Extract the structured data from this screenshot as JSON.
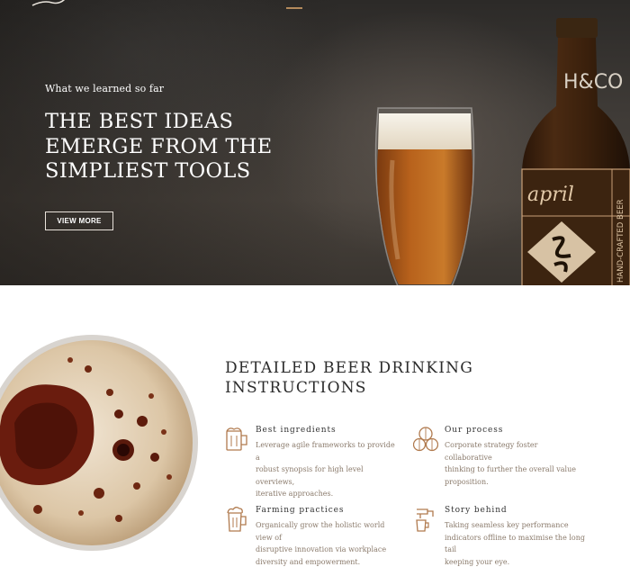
{
  "hero": {
    "eyebrow": "What we learned so far",
    "headline_lines": [
      "THE BEST IDEAS",
      "EMERGE FROM THE",
      "SIMPLIEST TOOLS"
    ],
    "button_label": "VIEW MORE",
    "accent_color": "#b48a5c",
    "bottle_label": {
      "brand": "H&CO",
      "script_text": "april",
      "vertical_text": "HAND-CRAFTED BEER"
    }
  },
  "section": {
    "title_lines": [
      "DETAILED BEER DRINKING",
      "INSTRUCTIONS"
    ],
    "features": [
      {
        "title": "Best ingredients",
        "icon": "beer-mug-icon",
        "lines": [
          "Leverage agile frameworks to provide a",
          "robust synopsis for high level overviews,",
          "iterative approaches."
        ]
      },
      {
        "title": "Our process",
        "icon": "barrels-icon",
        "lines": [
          "Corporate strategy foster collaborative",
          "thinking to further the overall value",
          "proposition."
        ]
      },
      {
        "title": "Farming practices",
        "icon": "beer-pint-icon",
        "lines": [
          "Organically grow the holistic world view of",
          "disruptive innovation via workplace",
          "diversity and empowerment."
        ]
      },
      {
        "title": "Story behind",
        "icon": "beer-tap-icon",
        "lines": [
          "Taking seamless key performance",
          "indicators offline to maximise the long tail",
          "keeping your eye."
        ]
      }
    ]
  }
}
